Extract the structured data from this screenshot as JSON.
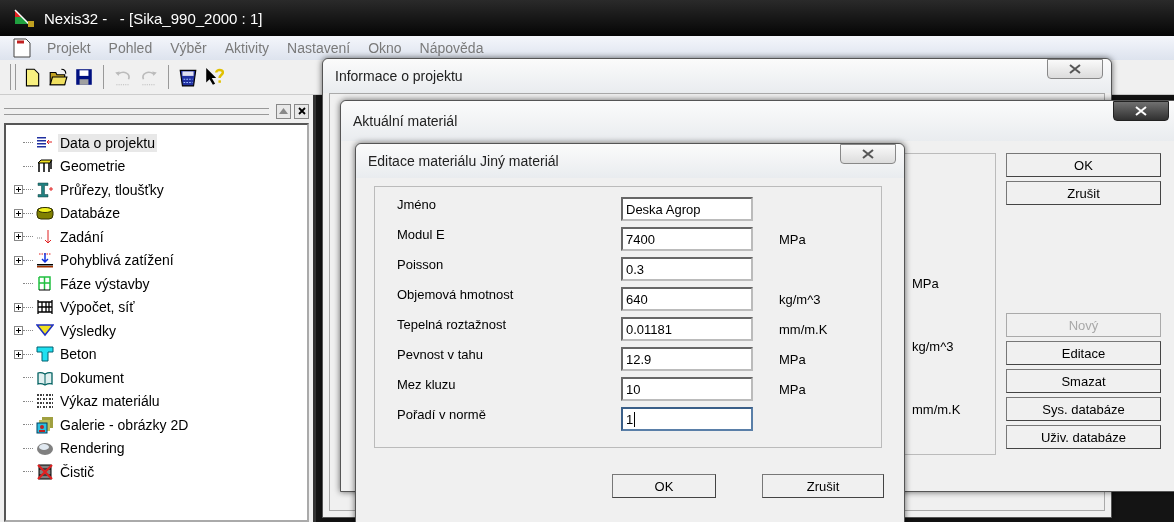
{
  "window": {
    "title": "Nexis32 -   - [Sika_990_2000 : 1]"
  },
  "menu": [
    {
      "label": "Projekt"
    },
    {
      "label": "Pohled"
    },
    {
      "label": "Výběr"
    },
    {
      "label": "Aktivity"
    },
    {
      "label": "Nastavení"
    },
    {
      "label": "Okno"
    },
    {
      "label": "Nápověda"
    }
  ],
  "toolbar": [
    {
      "kind": "new",
      "disabled": false
    },
    {
      "kind": "open",
      "disabled": false
    },
    {
      "kind": "save",
      "disabled": false
    },
    {
      "kind": "undo",
      "disabled": true
    },
    {
      "kind": "redo",
      "disabled": true
    },
    {
      "kind": "calc",
      "disabled": false
    },
    {
      "kind": "help",
      "disabled": false
    }
  ],
  "tree": [
    {
      "label": "Data o projektu",
      "expandable": false,
      "selected": true
    },
    {
      "label": "Geometrie",
      "expandable": false,
      "selected": false
    },
    {
      "label": "Průřezy, tloušťky",
      "expandable": true,
      "selected": false
    },
    {
      "label": "Databáze",
      "expandable": true,
      "selected": false
    },
    {
      "label": "Zadání",
      "expandable": true,
      "selected": false
    },
    {
      "label": "Pohyblivá zatížení",
      "expandable": true,
      "selected": false
    },
    {
      "label": "Fáze výstavby",
      "expandable": false,
      "selected": false
    },
    {
      "label": "Výpočet, síť",
      "expandable": true,
      "selected": false
    },
    {
      "label": "Výsledky",
      "expandable": true,
      "selected": false
    },
    {
      "label": "Beton",
      "expandable": true,
      "selected": false
    },
    {
      "label": "Dokument",
      "expandable": false,
      "selected": false
    },
    {
      "label": "Výkaz materiálu",
      "expandable": false,
      "selected": false
    },
    {
      "label": "Galerie - obrázky 2D",
      "expandable": false,
      "selected": false
    },
    {
      "label": "Rendering",
      "expandable": false,
      "selected": false
    },
    {
      "label": "Čistič",
      "expandable": false,
      "selected": false
    }
  ],
  "project_dialog": {
    "title": "Informace o projektu"
  },
  "material_dialog": {
    "title": "Aktuální materiál",
    "units": [
      "MPa",
      "kg/m^3",
      "mm/m.K"
    ],
    "buttons_top": [
      {
        "label": "OK",
        "disabled": false
      },
      {
        "label": "Zrušit",
        "disabled": false
      }
    ],
    "buttons_bottom": [
      {
        "label": "Nový",
        "disabled": true
      },
      {
        "label": "Editace",
        "disabled": false
      },
      {
        "label": "Smazat",
        "disabled": false
      },
      {
        "label": "Sys. databáze",
        "disabled": false
      },
      {
        "label": "Uživ. databáze",
        "disabled": false
      }
    ]
  },
  "edit_dialog": {
    "title": "Editace materiálu Jiný materiál",
    "fields": [
      {
        "label": "Jméno",
        "value": "Deska Agrop",
        "focused": false
      },
      {
        "label": "Modul E",
        "value": "7400",
        "unit": "MPa",
        "focused": false
      },
      {
        "label": "Poisson",
        "value": "0.3",
        "focused": false
      },
      {
        "label": "Objemová hmotnost",
        "value": "640",
        "unit": "kg/m^3",
        "focused": false
      },
      {
        "label": "Tepelná roztažnost",
        "value": "0.01181",
        "unit": "mm/m.K",
        "focused": false
      },
      {
        "label": "Pevnost v tahu",
        "value": "12.9",
        "unit": "MPa",
        "focused": false
      },
      {
        "label": "Mez kluzu",
        "value": "10",
        "unit": "MPa",
        "focused": false
      },
      {
        "label": "Pořadí v normě",
        "value": "1",
        "focused": true
      }
    ],
    "buttons": [
      {
        "label": "OK"
      },
      {
        "label": "Zrušit"
      }
    ]
  }
}
